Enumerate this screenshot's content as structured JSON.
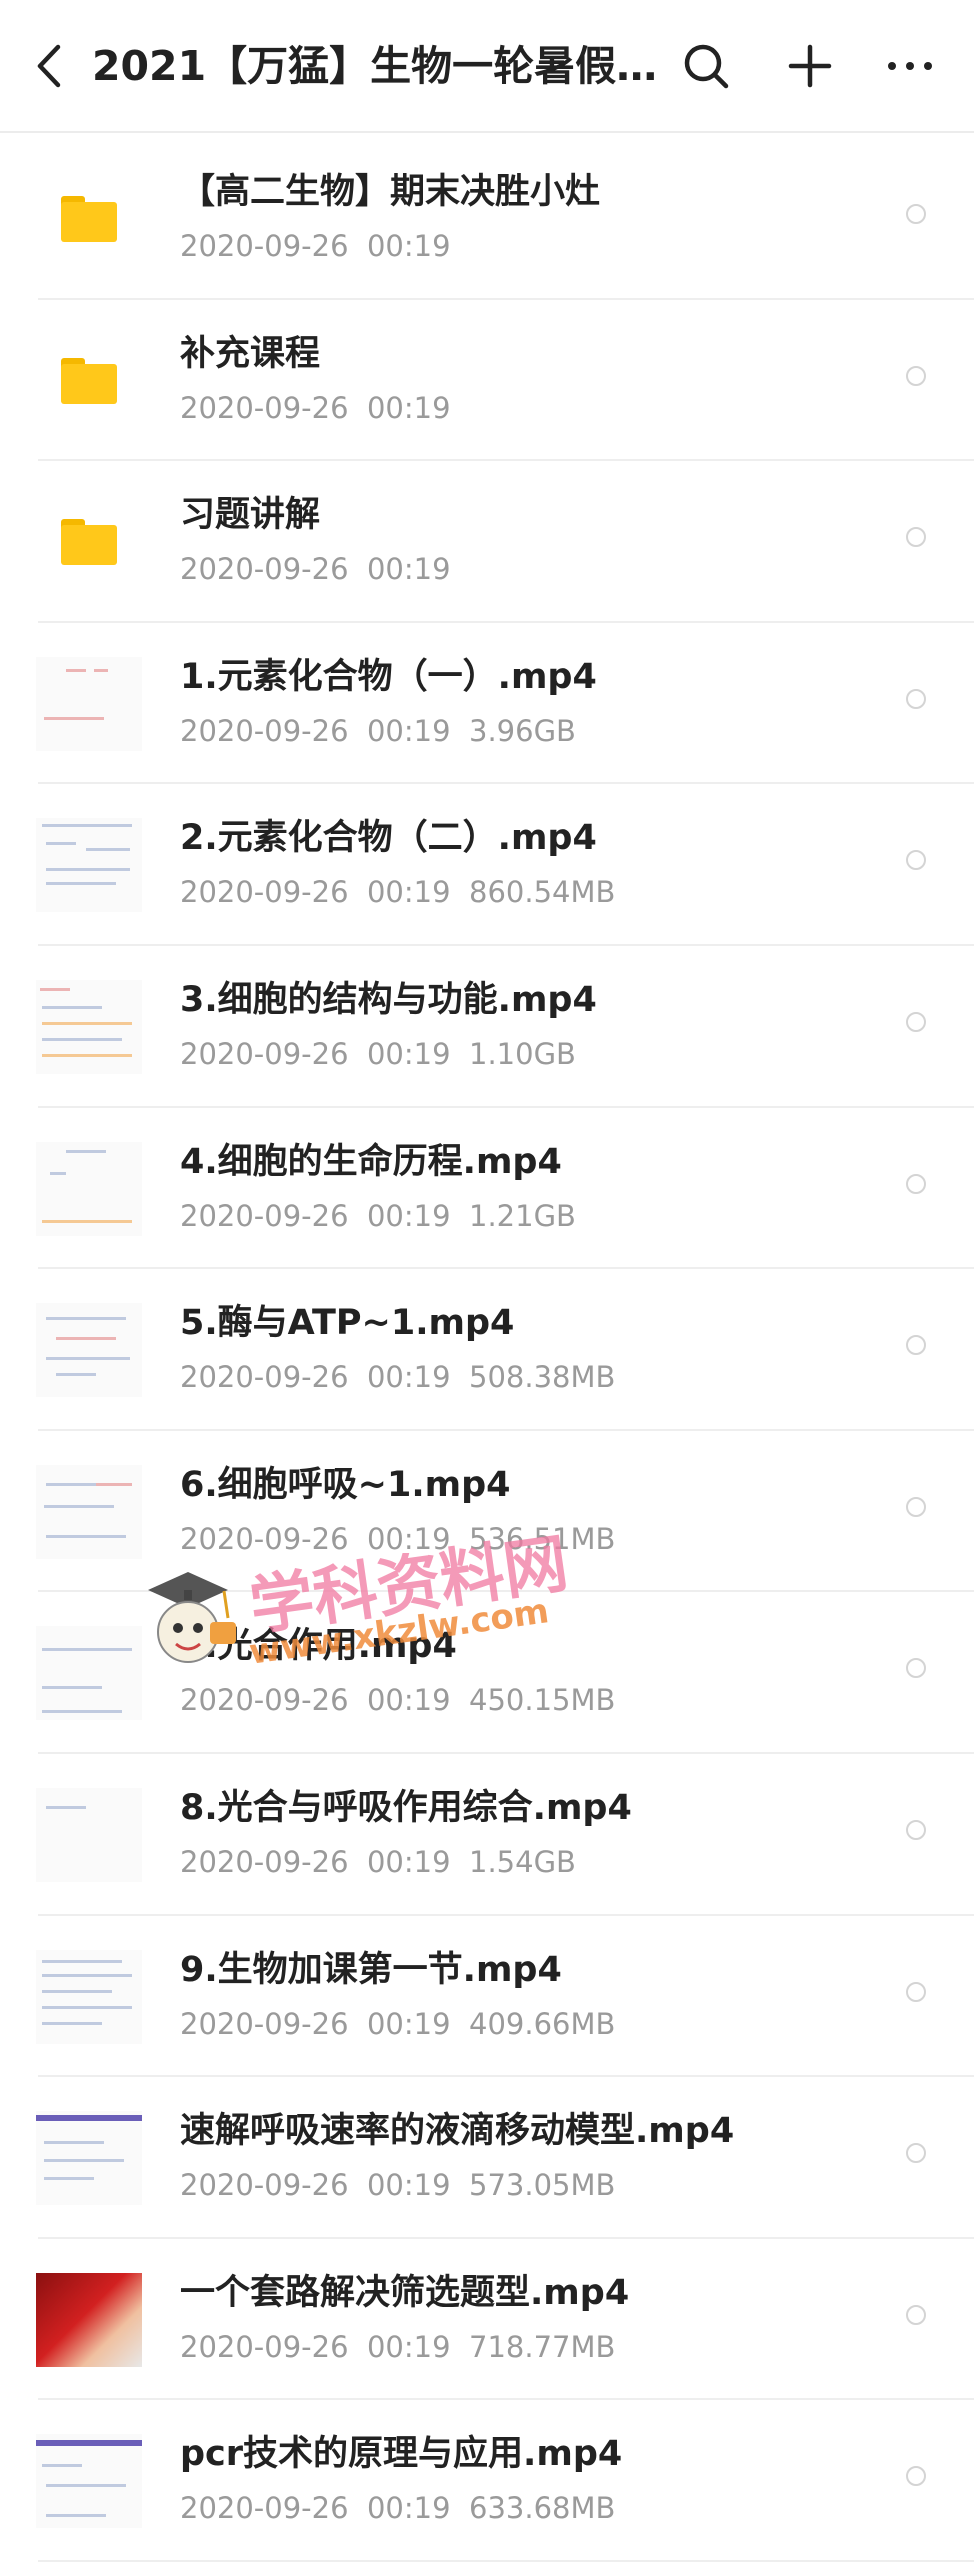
{
  "header": {
    "title": "2021【万猛】生物一轮暑假…",
    "back_icon": "chevron-left-icon",
    "search_icon": "search-icon",
    "add_icon": "plus-icon",
    "more_icon": "more-horizontal-icon"
  },
  "files": [
    {
      "type": "folder",
      "name": "【高二生物】期末决胜小灶",
      "date": "2020-09-26",
      "time": "00:19",
      "size": ""
    },
    {
      "type": "folder",
      "name": "补充课程",
      "date": "2020-09-26",
      "time": "00:19",
      "size": ""
    },
    {
      "type": "folder",
      "name": "习题讲解",
      "date": "2020-09-26",
      "time": "00:19",
      "size": ""
    },
    {
      "type": "video",
      "name": "1.元素化合物（一）.mp4",
      "date": "2020-09-26",
      "time": "00:19",
      "size": "3.96GB"
    },
    {
      "type": "video",
      "name": "2.元素化合物（二）.mp4",
      "date": "2020-09-26",
      "time": "00:19",
      "size": "860.54MB"
    },
    {
      "type": "video",
      "name": "3.细胞的结构与功能.mp4",
      "date": "2020-09-26",
      "time": "00:19",
      "size": "1.10GB"
    },
    {
      "type": "video",
      "name": "4.细胞的生命历程.mp4",
      "date": "2020-09-26",
      "time": "00:19",
      "size": "1.21GB"
    },
    {
      "type": "video",
      "name": "5.酶与ATP~1.mp4",
      "date": "2020-09-26",
      "time": "00:19",
      "size": "508.38MB"
    },
    {
      "type": "video",
      "name": "6.细胞呼吸~1.mp4",
      "date": "2020-09-26",
      "time": "00:19",
      "size": "536.51MB"
    },
    {
      "type": "video",
      "name": "7.光合作用.mp4",
      "date": "2020-09-26",
      "time": "00:19",
      "size": "450.15MB"
    },
    {
      "type": "video",
      "name": "8.光合与呼吸作用综合.mp4",
      "date": "2020-09-26",
      "time": "00:19",
      "size": "1.54GB"
    },
    {
      "type": "video",
      "name": "9.生物加课第一节.mp4",
      "date": "2020-09-26",
      "time": "00:19",
      "size": "409.66MB"
    },
    {
      "type": "video",
      "name": "速解呼吸速率的液滴移动模型.mp4",
      "date": "2020-09-26",
      "time": "00:19",
      "size": "573.05MB"
    },
    {
      "type": "video",
      "name": "一个套路解决筛选题型.mp4",
      "date": "2020-09-26",
      "time": "00:19",
      "size": "718.77MB"
    },
    {
      "type": "video",
      "name": "pcr技术的原理与应用.mp4",
      "date": "2020-09-26",
      "time": "00:19",
      "size": "633.68MB"
    }
  ],
  "watermark": {
    "text": "学科资料网",
    "url": "www.xkzlw.com"
  },
  "colors": {
    "folder": "#ffc81a",
    "meta_text": "#9a9a9a",
    "divider": "#eeeeee"
  }
}
